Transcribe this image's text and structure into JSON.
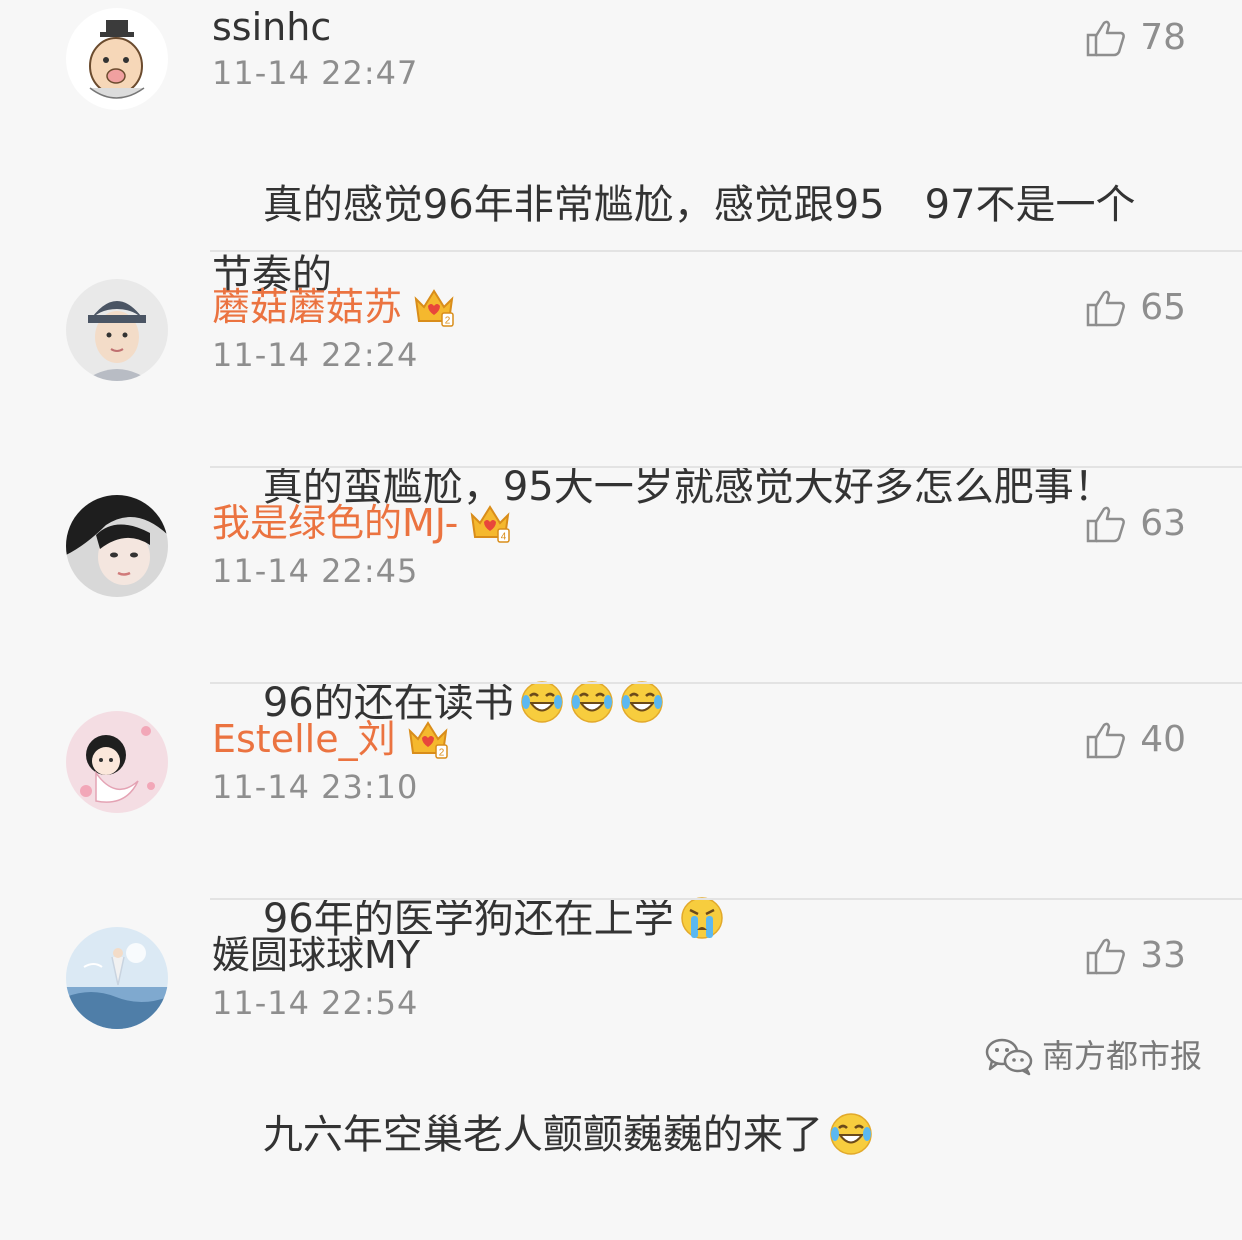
{
  "comments": [
    {
      "username": "ssinhc",
      "vip": false,
      "time": "11-14 22:47",
      "text": "真的感觉96年非常尴尬，感觉跟95　97不是一个节奏的",
      "likes": "78"
    },
    {
      "username": "蘑菇蘑菇苏",
      "vip": true,
      "vip_level": "2",
      "time": "11-14 22:24",
      "text": "真的蛮尴尬，95大一岁就感觉大好多怎么肥事！",
      "likes": "65"
    },
    {
      "username": "我是绿色的MJ-",
      "vip": true,
      "vip_level": "4",
      "time": "11-14 22:45",
      "text": "96的还在读书",
      "emoji": [
        "laugh-cry-emoji",
        "laugh-cry-emoji",
        "laugh-cry-emoji"
      ],
      "likes": "63"
    },
    {
      "username": "Estelle_刘",
      "vip": true,
      "vip_level": "2",
      "time": "11-14 23:10",
      "text": "96年的医学狗还在上学",
      "emoji": [
        "crying-emoji"
      ],
      "likes": "40"
    },
    {
      "username": "媛圆球球MY",
      "vip": false,
      "time": "11-14 22:54",
      "text": "九六年空巢老人颤颤巍巍的来了",
      "emoji": [
        "laugh-cry-emoji"
      ],
      "likes": "33"
    }
  ],
  "watermark": "南方都市报",
  "colors": {
    "background": "#f7f7f7",
    "vip_name": "#eb7340",
    "meta_gray": "#8e8e8e",
    "text": "#333333",
    "divider": "#e3e3e3",
    "crown_gold": "#f5b82e",
    "crown_red": "#e8463b"
  }
}
